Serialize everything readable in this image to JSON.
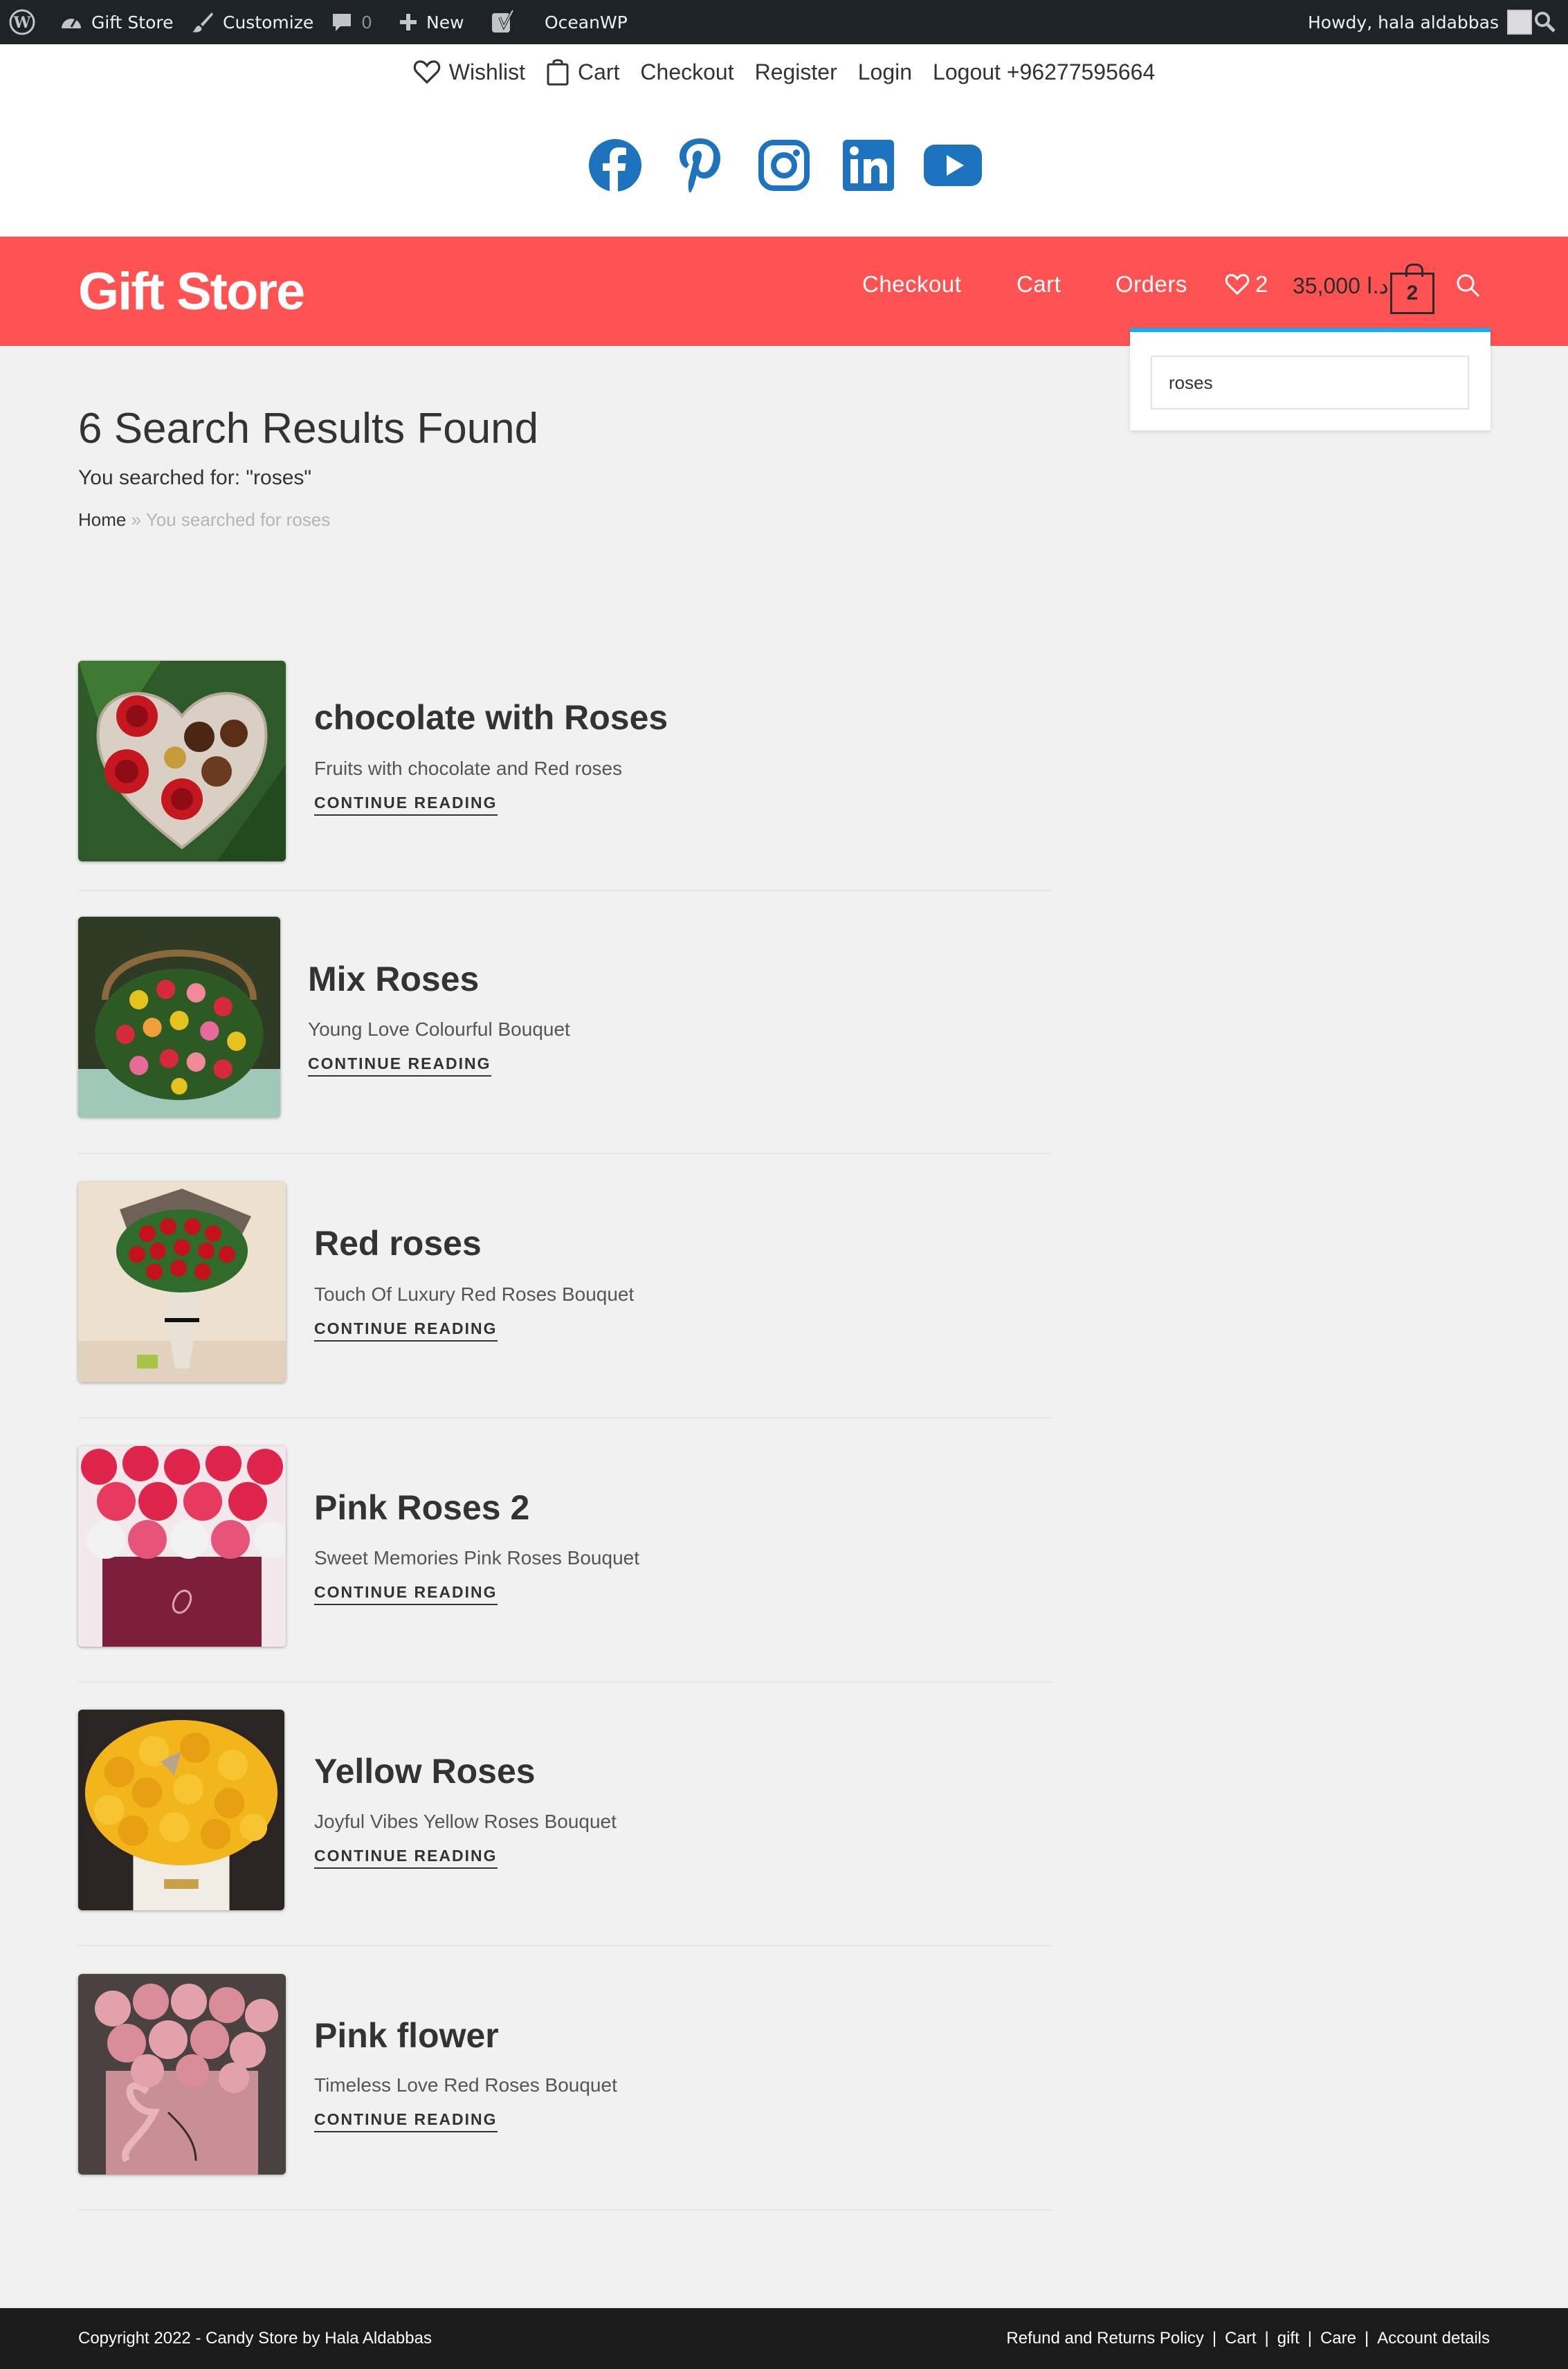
{
  "adminbar": {
    "site_name": "Gift Store",
    "customize": "Customize",
    "comments_count": "0",
    "new_label": "New",
    "theme": "OceanWP",
    "howdy": "Howdy, hala aldabbas"
  },
  "topbar": {
    "menu": [
      "Wishlist",
      "Cart",
      "Checkout",
      "Register",
      "Login",
      "Logout +96277595664"
    ],
    "social": [
      "facebook",
      "pinterest",
      "instagram",
      "linkedin",
      "youtube"
    ]
  },
  "header": {
    "logo": "Gift Store",
    "nav": [
      "Checkout",
      "Cart",
      "Orders"
    ],
    "wishlist_count": "2",
    "cart_amount": "د.ا 35,000",
    "cart_count": "2"
  },
  "search": {
    "value": "roses"
  },
  "page": {
    "title": "6 Search Results Found",
    "subheading": "You searched for: \"roses\"",
    "breadcrumb_home": "Home",
    "breadcrumb_sep": "»",
    "breadcrumb_current": "You searched for roses"
  },
  "results": [
    {
      "title": "chocolate with Roses",
      "excerpt": "Fruits with chocolate and Red roses",
      "more": "CONTINUE READING"
    },
    {
      "title": "Mix Roses",
      "excerpt": "Young Love Colourful Bouquet",
      "more": "CONTINUE READING"
    },
    {
      "title": "Red roses",
      "excerpt": "Touch Of Luxury Red Roses Bouquet",
      "more": "CONTINUE READING"
    },
    {
      "title": "Pink Roses 2",
      "excerpt": "Sweet Memories Pink Roses Bouquet",
      "more": "CONTINUE READING"
    },
    {
      "title": "Yellow Roses",
      "excerpt": "Joyful Vibes Yellow Roses Bouquet",
      "more": "CONTINUE READING"
    },
    {
      "title": "Pink flower",
      "excerpt": "Timeless Love Red Roses Bouquet",
      "more": "CONTINUE READING"
    }
  ],
  "footer": {
    "copyright": "Copyright 2022 - Candy Store by Hala Aldabbas",
    "menu": [
      "Refund and Returns Policy",
      "Cart",
      "gift",
      "Care",
      "Account details"
    ],
    "separator": "|"
  },
  "colors": {
    "header_bg": "#ff5252",
    "adminbar_bg": "#1d2327",
    "social_blue": "#1e73be",
    "search_accent": "#13aff0",
    "footer_bg": "#1b1b1b"
  }
}
